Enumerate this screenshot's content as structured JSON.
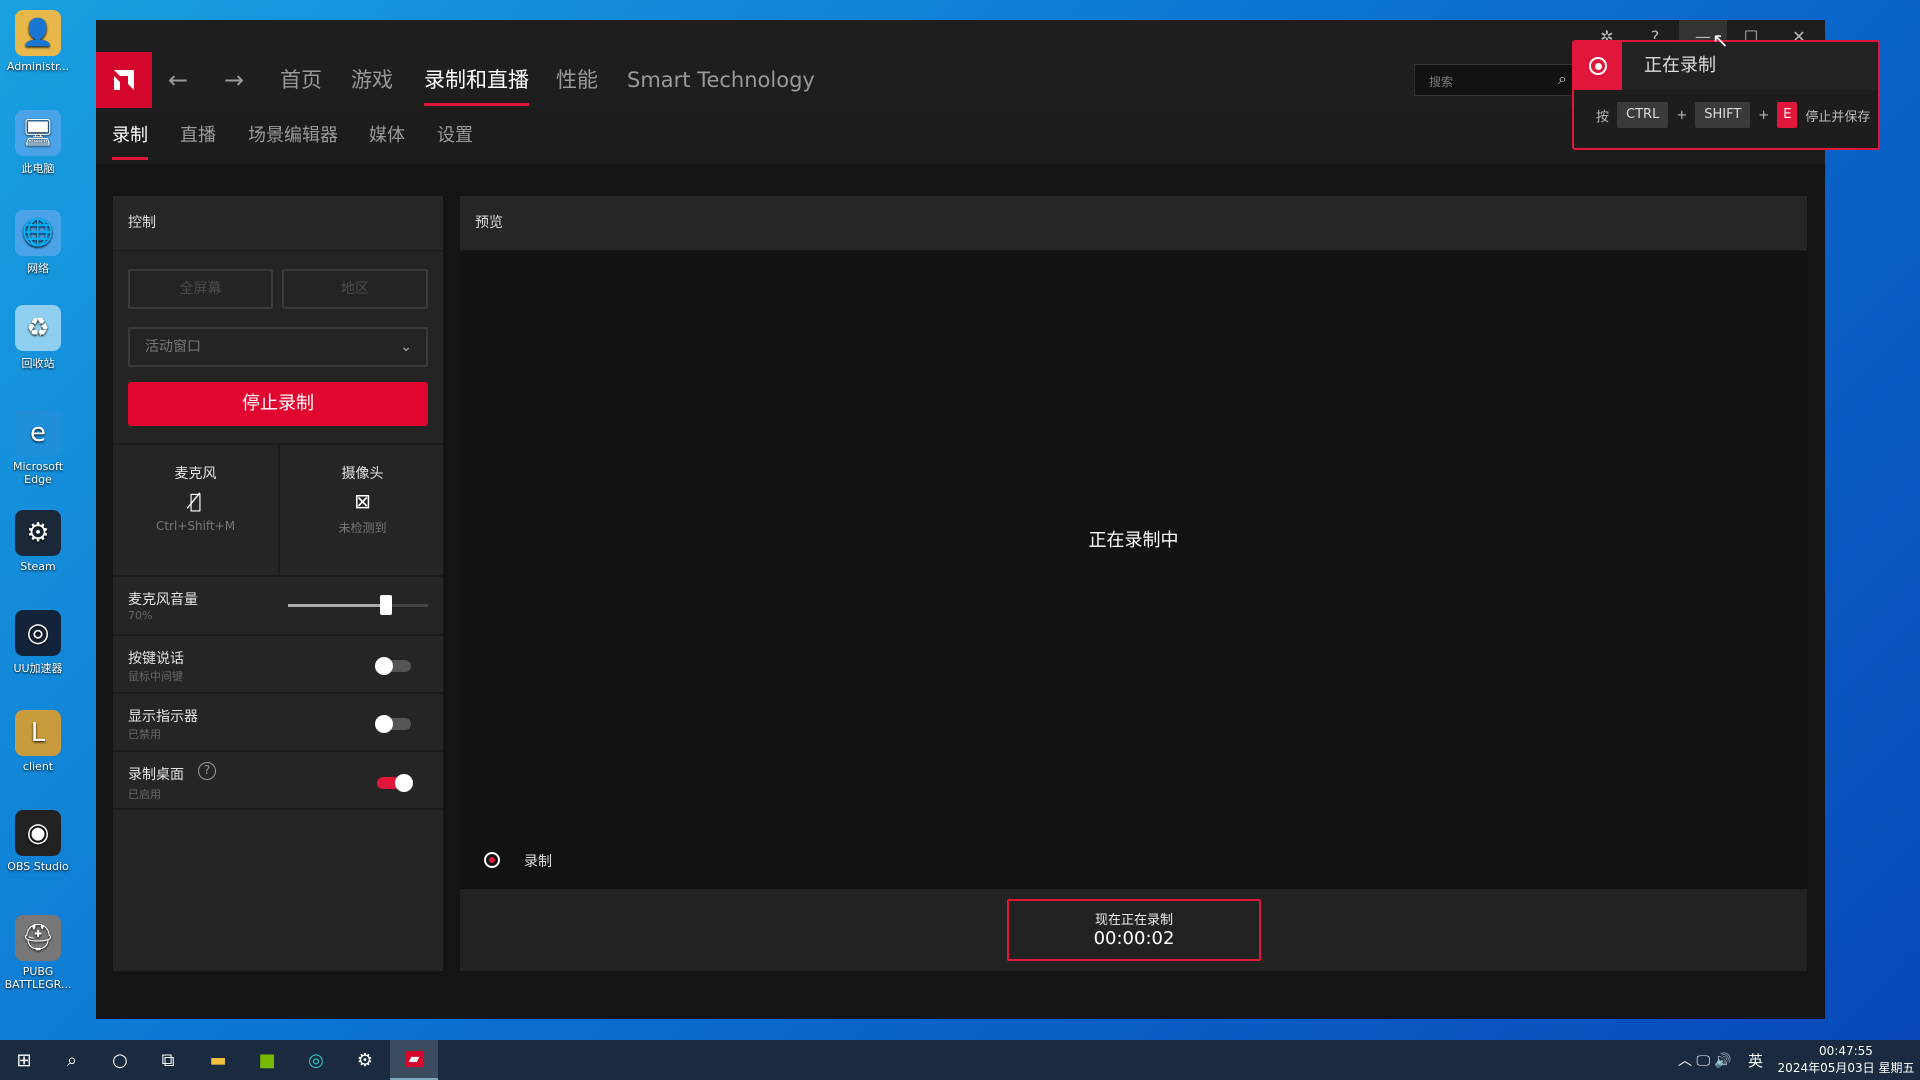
{
  "desktop": {
    "icons": [
      {
        "label": "Administr...",
        "glyph": "👤",
        "color": "#e8b84a"
      },
      {
        "label": "此电脑",
        "glyph": "🖥",
        "color": "#4aa3e8"
      },
      {
        "label": "网络",
        "glyph": "🌐",
        "color": "#4aa3e8"
      },
      {
        "label": "回收站",
        "glyph": "♻",
        "color": "#8fd0f0"
      },
      {
        "label": "Microsoft Edge",
        "glyph": "e",
        "color": "#1e8fd8"
      },
      {
        "label": "Steam",
        "glyph": "⚙",
        "color": "#1b2838"
      },
      {
        "label": "UU加速器",
        "glyph": "◎",
        "color": "#13233a"
      },
      {
        "label": "client",
        "glyph": "L",
        "color": "#c89b3c"
      },
      {
        "label": "OBS Studio",
        "glyph": "◉",
        "color": "#222"
      },
      {
        "label": "PUBG BATTLEGR...",
        "glyph": "⛑",
        "color": "#777"
      }
    ]
  },
  "app": {
    "nav": {
      "back_icon": "arrow-left-icon",
      "forward_icon": "arrow-right-icon",
      "items": [
        "首页",
        "游戏",
        "录制和直播",
        "性能",
        "Smart Technology"
      ],
      "active": 2,
      "search_placeholder": "搜索"
    },
    "subnav": {
      "items": [
        "录制",
        "直播",
        "场景编辑器",
        "媒体",
        "设置"
      ],
      "active": 0
    },
    "control": {
      "title": "控制",
      "fullscreen": "全屏幕",
      "region": "地区",
      "window_select": "活动窗口",
      "stop_button": "停止录制",
      "mic": {
        "label": "麦克风",
        "shortcut": "Ctrl+Shift+M"
      },
      "camera": {
        "label": "摄像头",
        "status": "未检测到"
      },
      "mic_volume": {
        "label": "麦克风音量",
        "value": "70%",
        "level": 70
      },
      "push_to_talk": {
        "label": "按键说话",
        "sub": "鼠标中间键",
        "on": false
      },
      "show_indicator": {
        "label": "显示指示器",
        "sub": "已禁用",
        "on": false
      },
      "record_desktop": {
        "label": "录制桌面",
        "sub": "已启用",
        "on": true
      }
    },
    "preview": {
      "title": "预览",
      "status": "正在录制中",
      "rec_label": "录制",
      "now_recording": "现在正在录制",
      "timer": "00:00:02"
    }
  },
  "overlay": {
    "title": "正在录制",
    "press": "按",
    "keys": [
      "CTRL",
      "SHIFT",
      "E"
    ],
    "plus": "+",
    "action": "停止并保存"
  },
  "taskbar": {
    "ime": "英",
    "time": "00:47:55",
    "date": "2024年05月03日 星期五"
  },
  "colors": {
    "accent": "#e0173a",
    "amd_red": "#d4062b"
  }
}
